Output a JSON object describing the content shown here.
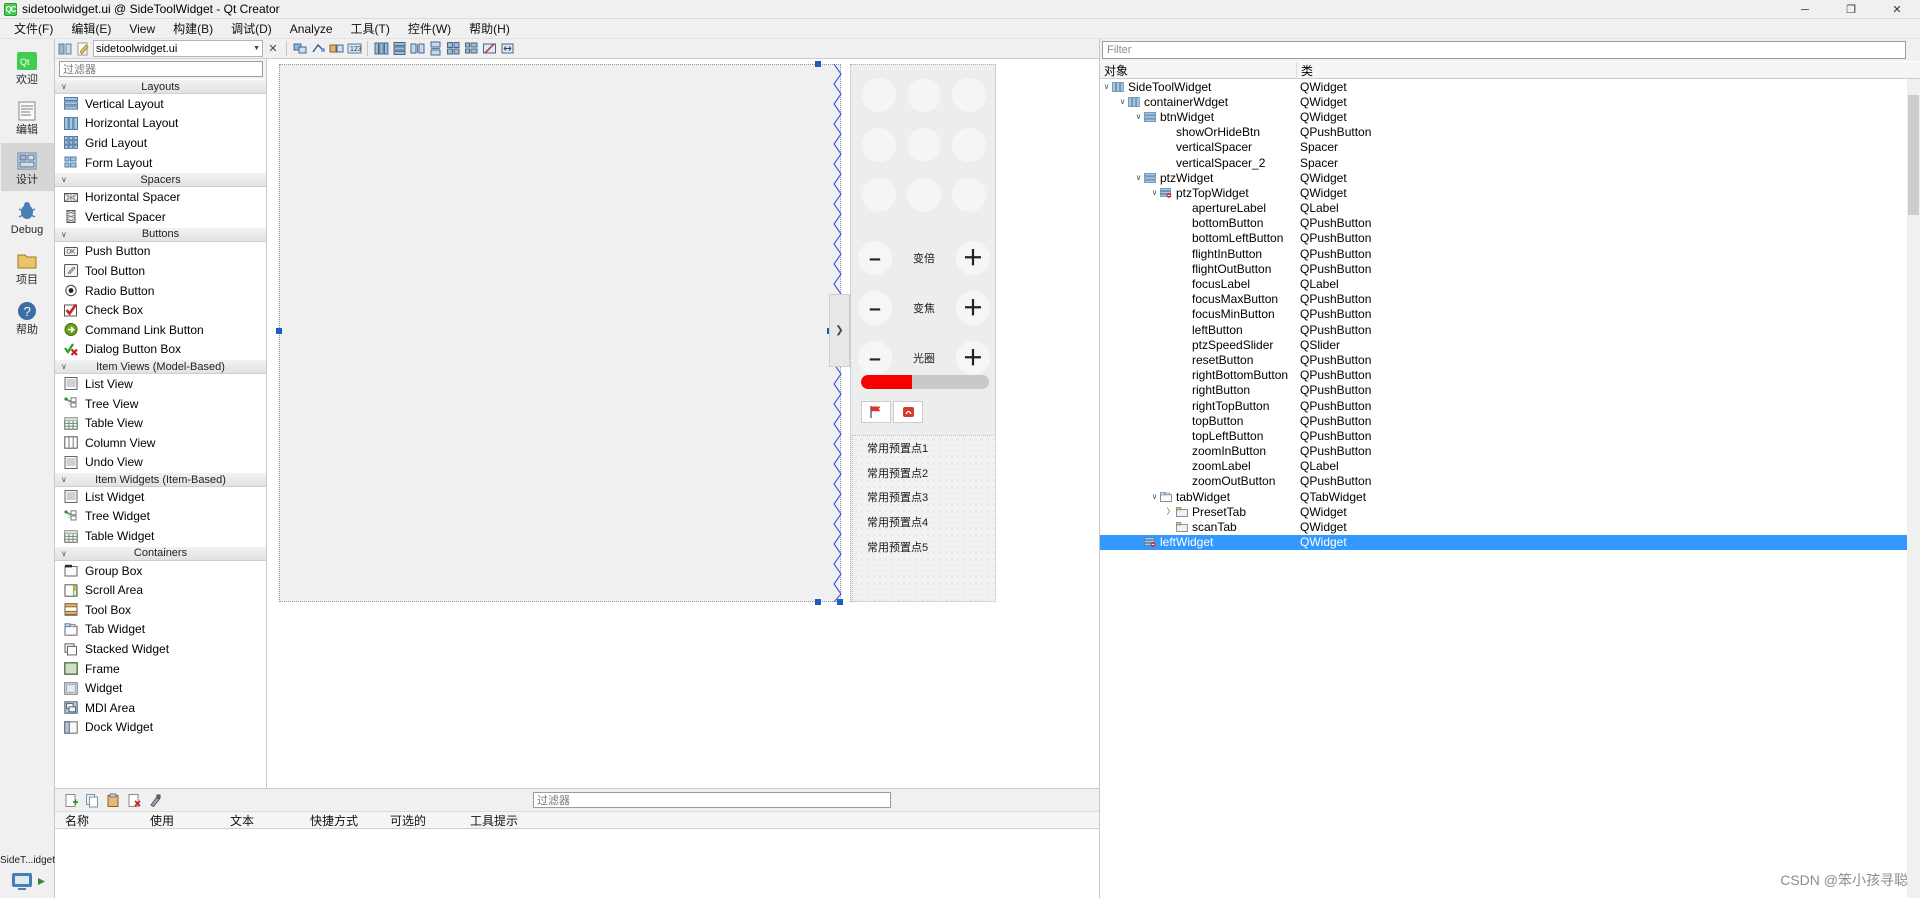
{
  "titlebar": {
    "logo_text": "QC",
    "title": "sidetoolwidget.ui @ SideToolWidget - Qt Creator",
    "minimize": "─",
    "maximize": "❐",
    "close": "✕"
  },
  "menubar": {
    "items": [
      {
        "label": "文件(F)",
        "name": "menu-file"
      },
      {
        "label": "编辑(E)",
        "name": "menu-edit"
      },
      {
        "label": "View",
        "name": "menu-view"
      },
      {
        "label": "构建(B)",
        "name": "menu-build"
      },
      {
        "label": "调试(D)",
        "name": "menu-debug"
      },
      {
        "label": "Analyze",
        "name": "menu-analyze"
      },
      {
        "label": "工具(T)",
        "name": "menu-tools"
      },
      {
        "label": "控件(W)",
        "name": "menu-window"
      },
      {
        "label": "帮助(H)",
        "name": "menu-help"
      }
    ]
  },
  "modebar": {
    "items": [
      {
        "label": "欢迎",
        "icon": "welcome-icon",
        "active": false
      },
      {
        "label": "编辑",
        "icon": "edit-icon",
        "active": false
      },
      {
        "label": "设计",
        "icon": "design-icon",
        "active": true
      },
      {
        "label": "Debug",
        "icon": "debug-icon",
        "active": false
      },
      {
        "label": "项目",
        "icon": "projects-icon",
        "active": false
      },
      {
        "label": "帮助",
        "icon": "help-icon",
        "active": false
      }
    ],
    "run_target": "SideT...idget",
    "run_icon": "run-icon"
  },
  "editor_toolbar": {
    "file_name": "sidetoolwidget.ui",
    "dropdown_arrow": "▼",
    "close_label": "✕",
    "icons": [
      "split-icon",
      "back-icon",
      "forward-icon",
      "edit-widgets-icon",
      "edit-signals-icon",
      "edit-buddies-icon",
      "edit-tab-order-icon",
      "layout-horizontal-icon",
      "layout-vertical-icon",
      "layout-splitter-h-icon",
      "layout-splitter-v-icon",
      "layout-grid-icon",
      "layout-form-icon",
      "layout-break-icon",
      "adjust-size-icon"
    ]
  },
  "widgetbox": {
    "filter_placeholder": "过滤器",
    "groups": [
      {
        "name": "Layouts",
        "items": [
          {
            "label": "Vertical Layout",
            "icon": "vertical-layout-icon"
          },
          {
            "label": "Horizontal Layout",
            "icon": "horizontal-layout-icon"
          },
          {
            "label": "Grid Layout",
            "icon": "grid-layout-icon"
          },
          {
            "label": "Form Layout",
            "icon": "form-layout-icon"
          }
        ]
      },
      {
        "name": "Spacers",
        "items": [
          {
            "label": "Horizontal Spacer",
            "icon": "horizontal-spacer-icon"
          },
          {
            "label": "Vertical Spacer",
            "icon": "vertical-spacer-icon"
          }
        ]
      },
      {
        "name": "Buttons",
        "items": [
          {
            "label": "Push Button",
            "icon": "push-button-icon"
          },
          {
            "label": "Tool Button",
            "icon": "tool-button-icon"
          },
          {
            "label": "Radio Button",
            "icon": "radio-button-icon"
          },
          {
            "label": "Check Box",
            "icon": "check-box-icon"
          },
          {
            "label": "Command Link Button",
            "icon": "command-link-icon"
          },
          {
            "label": "Dialog Button Box",
            "icon": "dialog-button-box-icon"
          }
        ]
      },
      {
        "name": "Item Views (Model-Based)",
        "items": [
          {
            "label": "List View",
            "icon": "list-view-icon"
          },
          {
            "label": "Tree View",
            "icon": "tree-view-icon"
          },
          {
            "label": "Table View",
            "icon": "table-view-icon"
          },
          {
            "label": "Column View",
            "icon": "column-view-icon"
          },
          {
            "label": "Undo View",
            "icon": "undo-view-icon"
          }
        ]
      },
      {
        "name": "Item Widgets (Item-Based)",
        "items": [
          {
            "label": "List Widget",
            "icon": "list-widget-icon"
          },
          {
            "label": "Tree Widget",
            "icon": "tree-widget-icon"
          },
          {
            "label": "Table Widget",
            "icon": "table-widget-icon"
          }
        ]
      },
      {
        "name": "Containers",
        "items": [
          {
            "label": "Group Box",
            "icon": "group-box-icon"
          },
          {
            "label": "Scroll Area",
            "icon": "scroll-area-icon"
          },
          {
            "label": "Tool Box",
            "icon": "tool-box-icon"
          },
          {
            "label": "Tab Widget",
            "icon": "tab-widget-icon"
          },
          {
            "label": "Stacked Widget",
            "icon": "stacked-widget-icon"
          },
          {
            "label": "Frame",
            "icon": "frame-icon"
          },
          {
            "label": "Widget",
            "icon": "widget-icon"
          },
          {
            "label": "MDI Area",
            "icon": "mdi-area-icon"
          },
          {
            "label": "Dock Widget",
            "icon": "dock-widget-icon"
          }
        ]
      }
    ]
  },
  "canvas": {
    "zoom_controls": [
      {
        "minus": "–",
        "label": "变倍",
        "plus": "＋",
        "name": "zoom-row"
      },
      {
        "minus": "–",
        "label": "变焦",
        "plus": "＋",
        "name": "focus-row"
      },
      {
        "minus": "–",
        "label": "光圈",
        "plus": "＋",
        "name": "aperture-row"
      }
    ],
    "slider_color": "#f70000",
    "slider_value_pct": 40,
    "tabs": [
      {
        "icon": "flag-icon",
        "name": "preset-tab"
      },
      {
        "icon": "scan-icon",
        "name": "scan-tab"
      }
    ],
    "presets": [
      "常用预置点1",
      "常用预置点2",
      "常用预置点3",
      "常用预置点4",
      "常用预置点5"
    ],
    "splitter_handle": "❯"
  },
  "action_editor": {
    "filter_placeholder": "过滤器",
    "toolbar_icons": [
      "new-action-icon",
      "copy-icon",
      "paste-icon",
      "delete-icon",
      "edit-icon"
    ],
    "columns": [
      "名称",
      "使用",
      "文本",
      "快捷方式",
      "可选的",
      "工具提示"
    ],
    "rows": []
  },
  "object_inspector": {
    "filter_placeholder": "Filter",
    "columns": [
      "对象",
      "类"
    ],
    "rows": [
      {
        "name": "SideToolWidget",
        "class": "QWidget",
        "indent": 1,
        "chev": "∨",
        "icon": "hlayout-icon"
      },
      {
        "name": "containerWdget",
        "class": "QWidget",
        "indent": 2,
        "chev": "∨",
        "icon": "hlayout-icon"
      },
      {
        "name": "btnWidget",
        "class": "QWidget",
        "indent": 3,
        "chev": "∨",
        "icon": "vlayout-icon"
      },
      {
        "name": "showOrHideBtn",
        "class": "QPushButton",
        "indent": 4,
        "chev": "",
        "icon": ""
      },
      {
        "name": "verticalSpacer",
        "class": "Spacer",
        "indent": 4,
        "chev": "",
        "icon": ""
      },
      {
        "name": "verticalSpacer_2",
        "class": "Spacer",
        "indent": 4,
        "chev": "",
        "icon": ""
      },
      {
        "name": "ptzWidget",
        "class": "QWidget",
        "indent": 3,
        "chev": "∨",
        "icon": "vlayout-icon"
      },
      {
        "name": "ptzTopWidget",
        "class": "QWidget",
        "indent": 4,
        "chev": "∨",
        "icon": "nolayout-icon"
      },
      {
        "name": "apertureLabel",
        "class": "QLabel",
        "indent": 5,
        "chev": "",
        "icon": ""
      },
      {
        "name": "bottomButton",
        "class": "QPushButton",
        "indent": 5,
        "chev": "",
        "icon": ""
      },
      {
        "name": "bottomLeftButton",
        "class": "QPushButton",
        "indent": 5,
        "chev": "",
        "icon": ""
      },
      {
        "name": "flightInButton",
        "class": "QPushButton",
        "indent": 5,
        "chev": "",
        "icon": ""
      },
      {
        "name": "flightOutButton",
        "class": "QPushButton",
        "indent": 5,
        "chev": "",
        "icon": ""
      },
      {
        "name": "focusLabel",
        "class": "QLabel",
        "indent": 5,
        "chev": "",
        "icon": ""
      },
      {
        "name": "focusMaxButton",
        "class": "QPushButton",
        "indent": 5,
        "chev": "",
        "icon": ""
      },
      {
        "name": "focusMinButton",
        "class": "QPushButton",
        "indent": 5,
        "chev": "",
        "icon": ""
      },
      {
        "name": "leftButton",
        "class": "QPushButton",
        "indent": 5,
        "chev": "",
        "icon": ""
      },
      {
        "name": "ptzSpeedSlider",
        "class": "QSlider",
        "indent": 5,
        "chev": "",
        "icon": ""
      },
      {
        "name": "resetButton",
        "class": "QPushButton",
        "indent": 5,
        "chev": "",
        "icon": ""
      },
      {
        "name": "rightBottomButton",
        "class": "QPushButton",
        "indent": 5,
        "chev": "",
        "icon": ""
      },
      {
        "name": "rightButton",
        "class": "QPushButton",
        "indent": 5,
        "chev": "",
        "icon": ""
      },
      {
        "name": "rightTopButton",
        "class": "QPushButton",
        "indent": 5,
        "chev": "",
        "icon": ""
      },
      {
        "name": "topButton",
        "class": "QPushButton",
        "indent": 5,
        "chev": "",
        "icon": ""
      },
      {
        "name": "topLeftButton",
        "class": "QPushButton",
        "indent": 5,
        "chev": "",
        "icon": ""
      },
      {
        "name": "zoomInButton",
        "class": "QPushButton",
        "indent": 5,
        "chev": "",
        "icon": ""
      },
      {
        "name": "zoomLabel",
        "class": "QLabel",
        "indent": 5,
        "chev": "",
        "icon": ""
      },
      {
        "name": "zoomOutButton",
        "class": "QPushButton",
        "indent": 5,
        "chev": "",
        "icon": ""
      },
      {
        "name": "tabWidget",
        "class": "QTabWidget",
        "indent": 4,
        "chev": "∨",
        "icon": "tabwidget-icon"
      },
      {
        "name": "PresetTab",
        "class": "QWidget",
        "indent": 5,
        "chev": "〉",
        "icon": "tabpage-icon"
      },
      {
        "name": "scanTab",
        "class": "QWidget",
        "indent": 5,
        "chev": "",
        "icon": "tabpage-icon"
      },
      {
        "name": "leftWidget",
        "class": "QWidget",
        "indent": 3,
        "chev": "",
        "icon": "nolayout-icon",
        "selected": true
      }
    ]
  },
  "watermark": "CSDN @笨小孩寻聪"
}
